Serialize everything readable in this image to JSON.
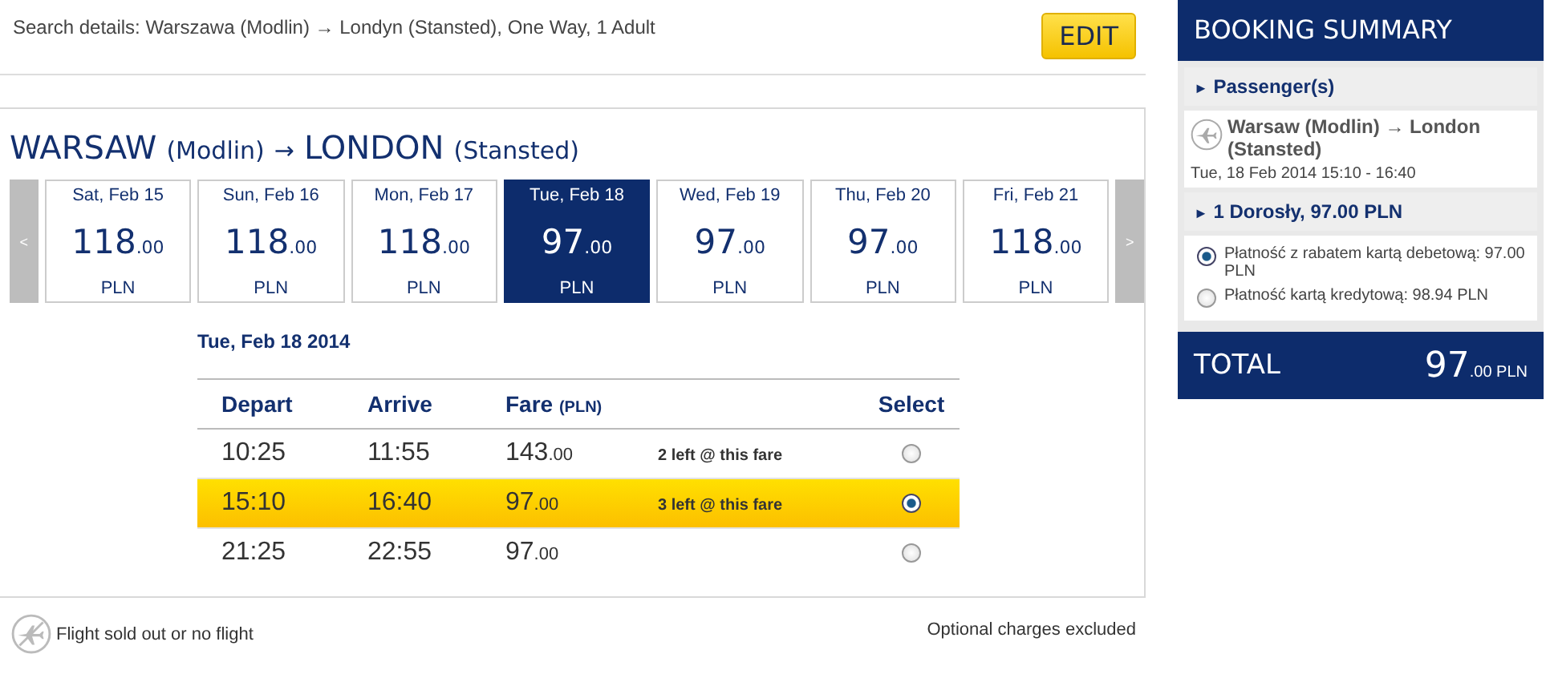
{
  "search": {
    "details": "Search details: Warszawa (Modlin) → Londyn (Stansted), One Way, 1 Adult",
    "edit_button": "EDIT"
  },
  "route": {
    "origin": "WARSAW",
    "origin_airport": "(Modlin)",
    "arrow": "→",
    "destination": "LONDON",
    "destination_airport": "(Stansted)"
  },
  "date_nav": {
    "prev": "<",
    "next": ">",
    "days": [
      {
        "label": "Sat, Feb 15",
        "price": "118",
        "decimals": ".00",
        "currency": "PLN",
        "selected": false
      },
      {
        "label": "Sun, Feb 16",
        "price": "118",
        "decimals": ".00",
        "currency": "PLN",
        "selected": false
      },
      {
        "label": "Mon, Feb 17",
        "price": "118",
        "decimals": ".00",
        "currency": "PLN",
        "selected": false
      },
      {
        "label": "Tue, Feb 18",
        "price": "97",
        "decimals": ".00",
        "currency": "PLN",
        "selected": true
      },
      {
        "label": "Wed, Feb 19",
        "price": "97",
        "decimals": ".00",
        "currency": "PLN",
        "selected": false
      },
      {
        "label": "Thu, Feb 20",
        "price": "97",
        "decimals": ".00",
        "currency": "PLN",
        "selected": false
      },
      {
        "label": "Fri, Feb 21",
        "price": "118",
        "decimals": ".00",
        "currency": "PLN",
        "selected": false
      }
    ]
  },
  "flights": {
    "date": "Tue, Feb 18 2014",
    "columns": {
      "depart": "Depart",
      "arrive": "Arrive",
      "fare": "Fare",
      "fare_unit": "(PLN)",
      "select": "Select"
    },
    "rows": [
      {
        "depart": "10:25",
        "arrive": "11:55",
        "fare": "143",
        "decimals": ".00",
        "availability": "2 left @ this fare",
        "selected": false
      },
      {
        "depart": "15:10",
        "arrive": "16:40",
        "fare": "97",
        "decimals": ".00",
        "availability": "3 left @ this fare",
        "selected": true
      },
      {
        "depart": "21:25",
        "arrive": "22:55",
        "fare": "97",
        "decimals": ".00",
        "selected": false
      }
    ]
  },
  "legend": {
    "sold_out": "Flight sold out or no flight",
    "note": "Optional charges excluded"
  },
  "summary": {
    "title": "BOOKING SUMMARY",
    "marker": "►",
    "passengers": "Passenger(s)",
    "flight": {
      "route": "Warsaw (Modlin) → London (Stansted)",
      "time": "Tue, 18 Feb 2014 15:10 - 16:40"
    },
    "fare_line": "1 Dorosły, 97.00 PLN",
    "payments": [
      {
        "label": "Płatność z rabatem kartą debetową: 97.00 PLN",
        "selected": true
      },
      {
        "label": "Płatność kartą kredytową: 98.94 PLN",
        "selected": false
      }
    ],
    "total": {
      "label": "TOTAL",
      "amount": "97",
      "decimals": ".00",
      "currency": "PLN"
    }
  }
}
